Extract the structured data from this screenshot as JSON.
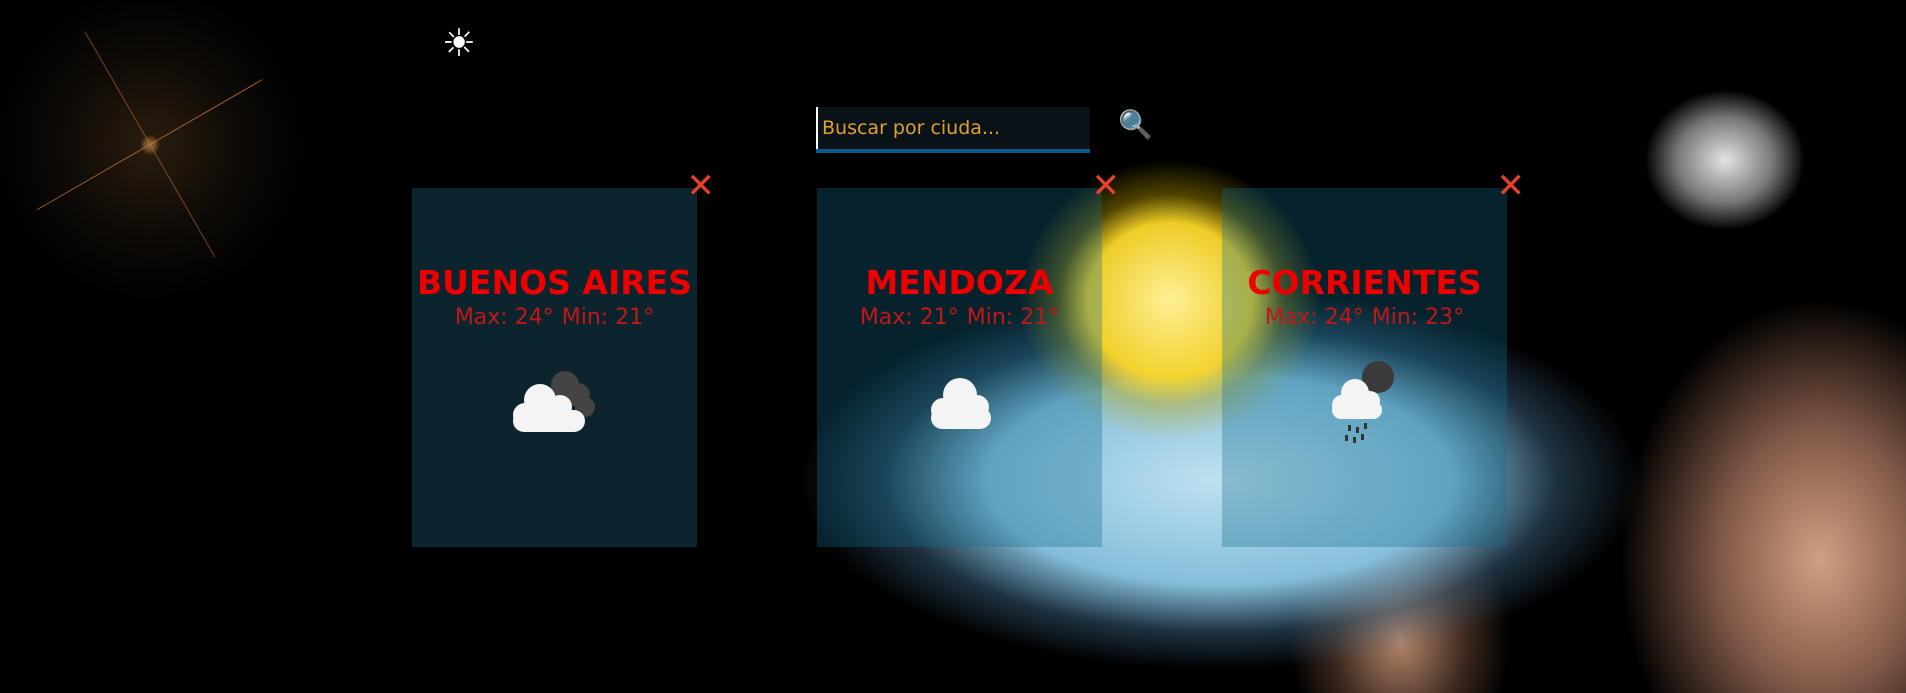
{
  "header": {
    "icons": [
      {
        "name": "umbrella-icon",
        "glyph": "☔"
      },
      {
        "name": "sun-icon",
        "glyph": "☀"
      }
    ]
  },
  "search": {
    "placeholder": "Buscar por ciuda...",
    "value": "",
    "button_icon": "🔍"
  },
  "cards": [
    {
      "city": "BUENOS AIRES",
      "max": "Max: 24°",
      "min": "Min: 21°",
      "icon": "cloudy-icon",
      "close": "✕"
    },
    {
      "city": "MENDOZA",
      "max": "Max: 21°",
      "min": "Min: 21°",
      "icon": "cloud-icon",
      "close": "✕"
    },
    {
      "city": "CORRIENTES",
      "max": "Max: 24°",
      "min": "Min: 23°",
      "icon": "rain-night-icon",
      "close": "✕"
    }
  ],
  "colors": {
    "city": "#e00000",
    "close": "#e8402a",
    "search_underline": "#0b5a8e",
    "placeholder": "#e0a030"
  }
}
